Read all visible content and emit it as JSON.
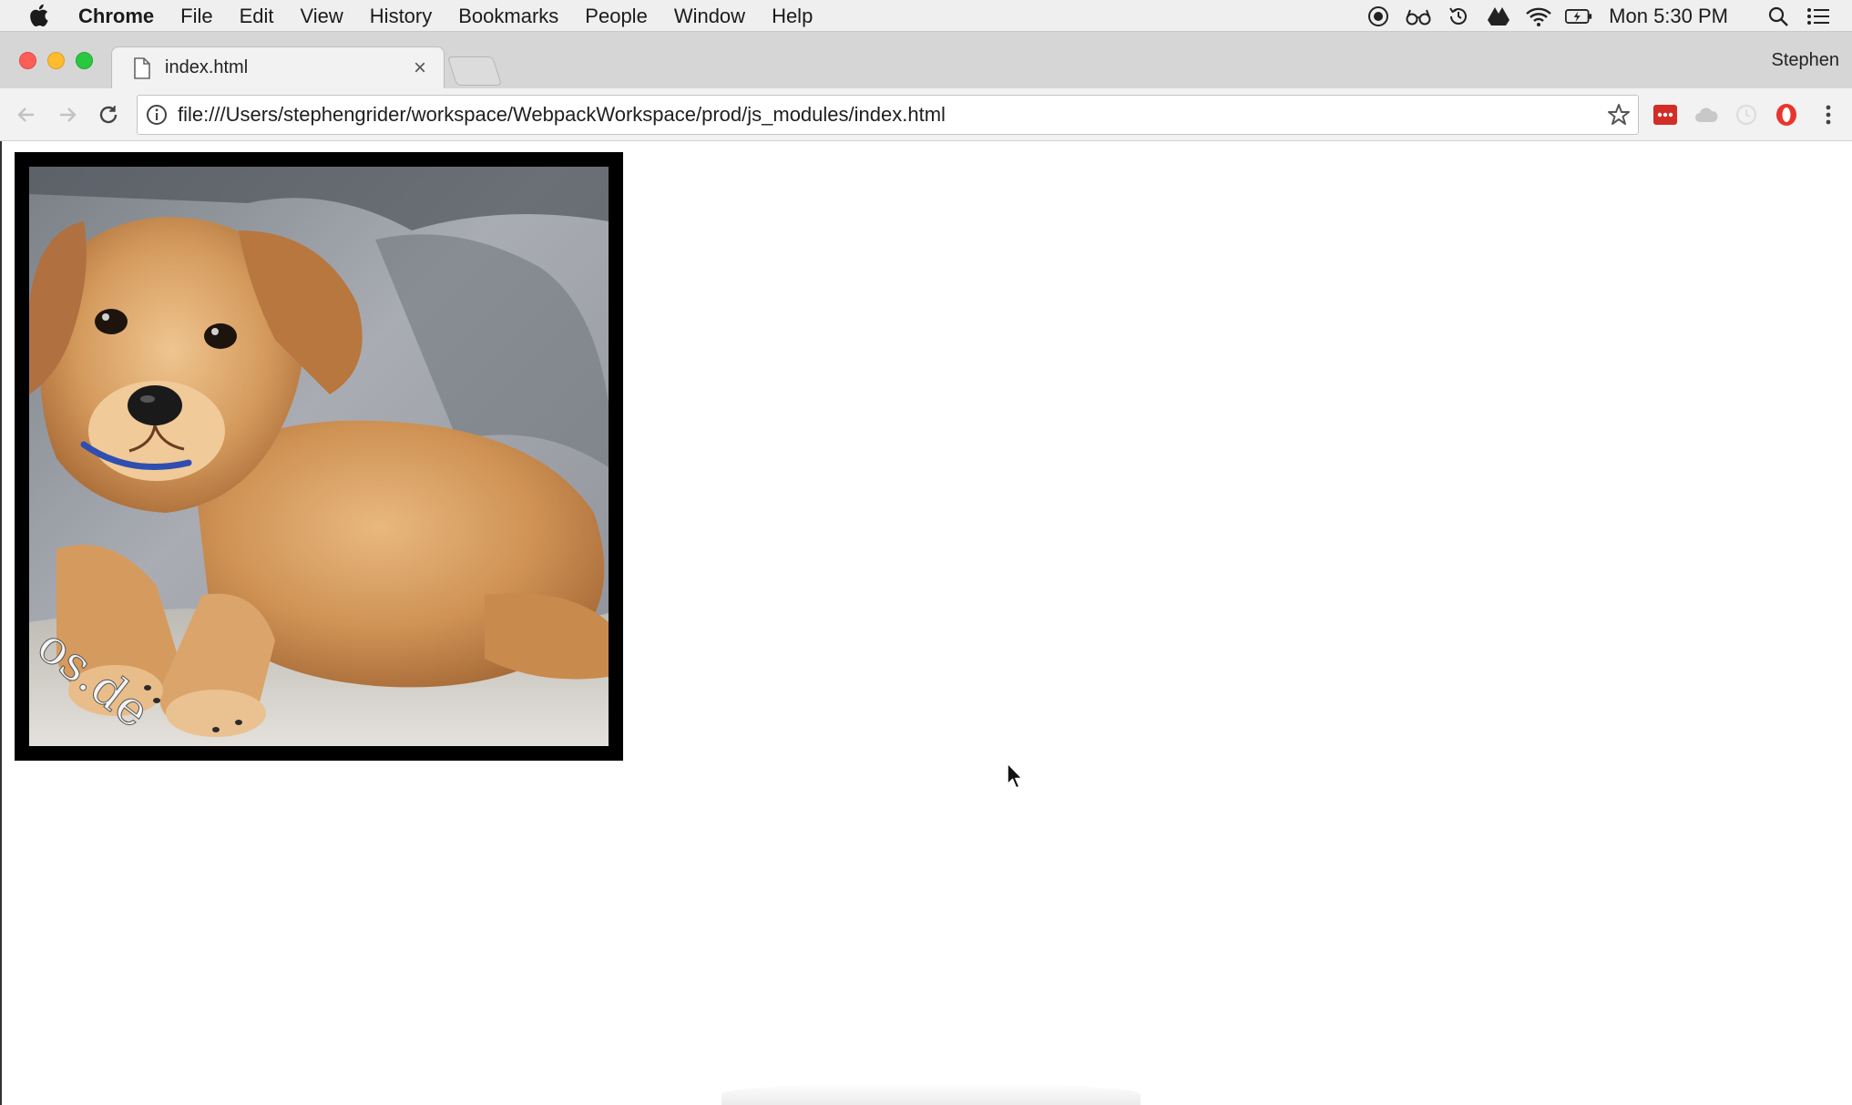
{
  "menubar": {
    "app_name": "Chrome",
    "items": [
      "File",
      "Edit",
      "View",
      "History",
      "Bookmarks",
      "People",
      "Window",
      "Help"
    ],
    "clock": "Mon 5:30 PM",
    "status_icons": [
      "screen-record-icon",
      "glasses-icon",
      "time-machine-icon",
      "drive-icon",
      "wifi-icon",
      "battery-icon",
      "spotlight-icon",
      "notification-center-icon"
    ]
  },
  "window": {
    "tab_title": "index.html",
    "profile_name": "Stephen",
    "url": "file:///Users/stephengrider/workspace/WebpackWorkspace/prod/js_modules/index.html",
    "extensions": [
      "lastpass-icon",
      "cloud-extension-icon",
      "refresh-extension-icon",
      "opera-extension-icon"
    ]
  },
  "page": {
    "image_subject": "puppy photo",
    "image_border_color": "#000000"
  }
}
